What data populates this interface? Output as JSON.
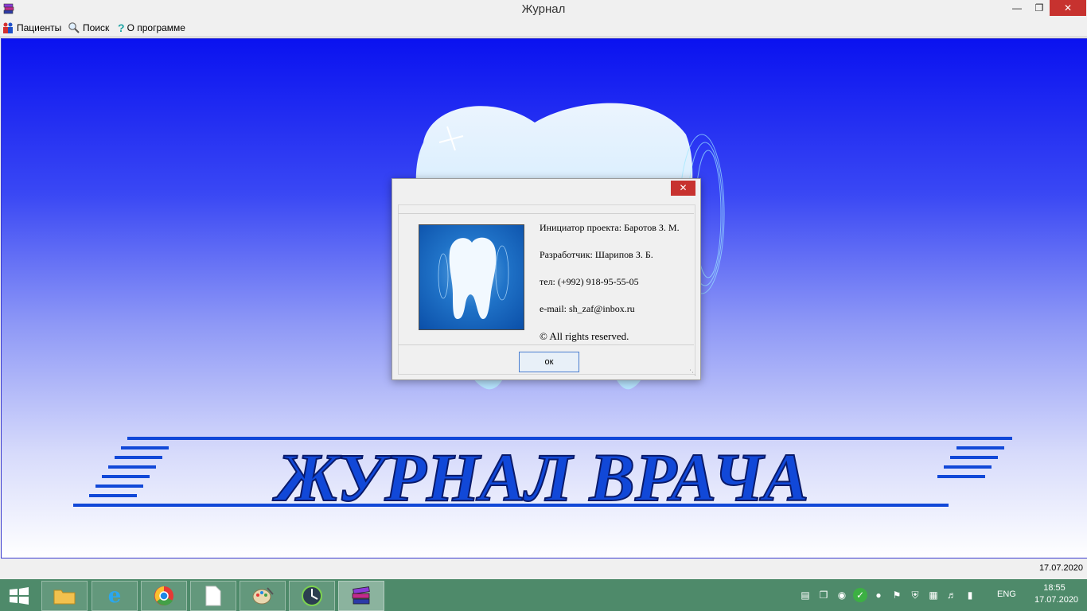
{
  "window": {
    "title": "Журнал"
  },
  "menu": {
    "patients": "Пациенты",
    "search": "Поиск",
    "about": "О программе"
  },
  "logo": {
    "text": "ЖУРНАЛ ВРАЧА"
  },
  "statusbar": {
    "date": "17.07.2020"
  },
  "dialog": {
    "line1": "Инициатор проекта: Баротов З. М.",
    "line2": "Разработчик: Шарипов З. Б.",
    "line3": "тел:   (+992) 918-95-55-05",
    "line4": "e-mail: sh_zaf@inbox.ru",
    "line5": "© All rights reserved.",
    "ok_label": "ок"
  },
  "taskbar": {
    "language": "ENG",
    "time": "18:55",
    "date": "17.07.2020"
  },
  "colors": {
    "canvas_top": "#0a12f0",
    "canvas_bottom": "#ffffff",
    "logo_blue": "#1148d8",
    "taskbar": "#4e8a6a",
    "close_red": "#c7322f"
  }
}
